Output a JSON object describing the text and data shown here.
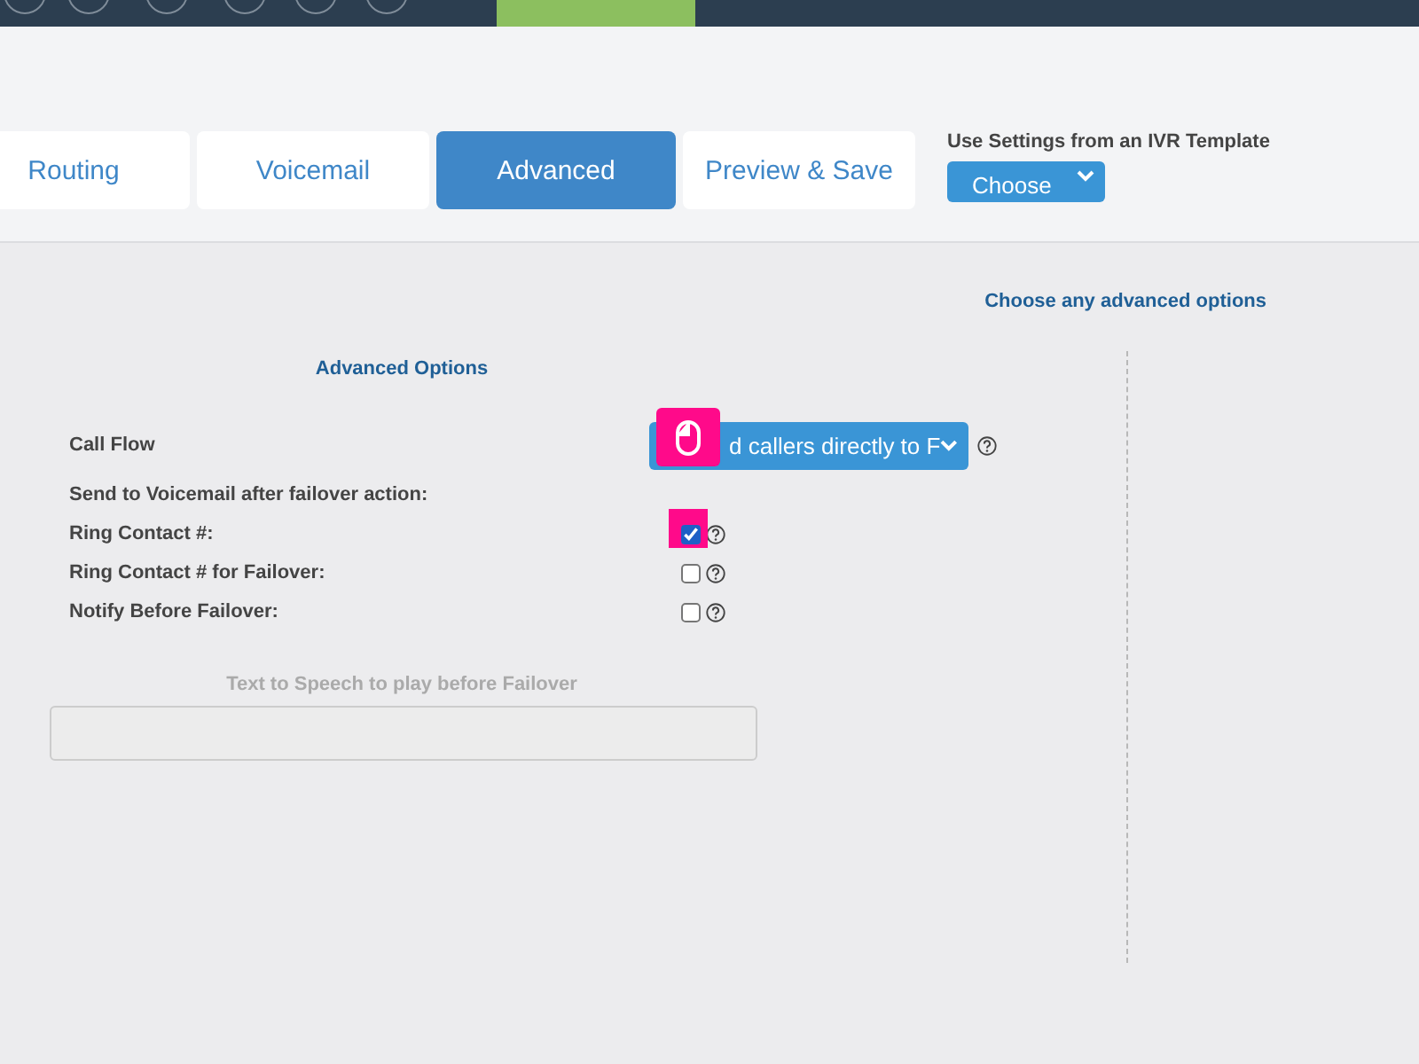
{
  "tabs": [
    {
      "label": "Routing",
      "selected": false
    },
    {
      "label": "Voicemail",
      "selected": false
    },
    {
      "label": "Advanced",
      "selected": true
    },
    {
      "label": "Preview & Save",
      "selected": false
    }
  ],
  "template": {
    "label": "Use Settings from an IVR Template",
    "button": "Choose"
  },
  "hint": "Choose any advanced options",
  "panel_title": "Advanced Options",
  "rows": [
    {
      "kind": "select",
      "label": "Call Flow",
      "value": "d callers directly to F"
    },
    {
      "kind": "text",
      "label": "Send to Voicemail after failover action:"
    },
    {
      "kind": "checkbox",
      "label": "Ring Contact #:",
      "checked": true
    },
    {
      "kind": "checkbox",
      "label": "Ring Contact # for Failover:",
      "checked": false
    },
    {
      "kind": "checkbox",
      "label": "Notify Before Failover:",
      "checked": false
    }
  ],
  "tts": {
    "label": "Text to Speech to play before Failover",
    "disabled": true
  }
}
